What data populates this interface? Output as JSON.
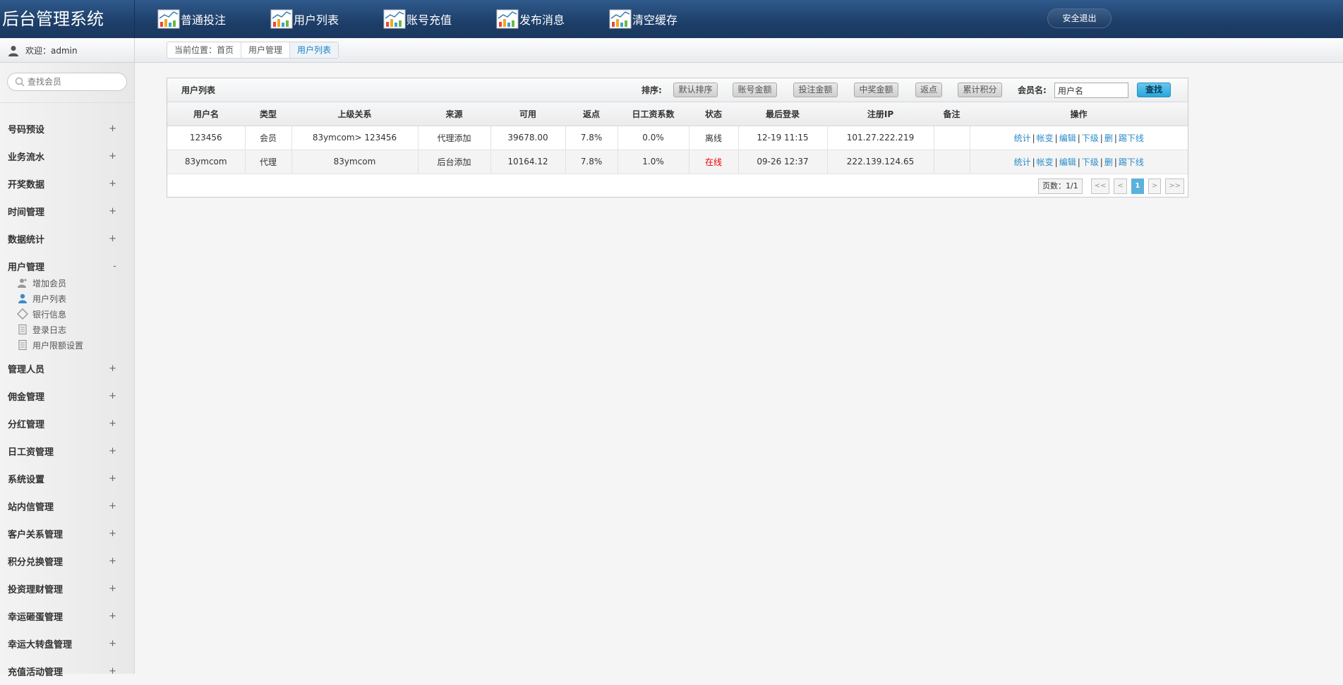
{
  "app": {
    "title": "后台管理系统"
  },
  "nav": [
    {
      "label": "普通投注"
    },
    {
      "label": "用户列表"
    },
    {
      "label": "账号充值"
    },
    {
      "label": "发布消息"
    },
    {
      "label": "清空缓存"
    }
  ],
  "logout_label": "安全退出",
  "welcome": "欢迎：admin",
  "breadcrumb": [
    "当前位置：首页",
    "用户管理",
    "用户列表"
  ],
  "sidebar": {
    "search_placeholder": "查找会员",
    "menu_before": [
      {
        "label": "号码预设",
        "sign": "+"
      },
      {
        "label": "业务流水",
        "sign": "+"
      },
      {
        "label": "开奖数据",
        "sign": "+"
      },
      {
        "label": "时间管理",
        "sign": "+"
      },
      {
        "label": "数据统计",
        "sign": "+"
      },
      {
        "label": "用户管理",
        "sign": "-"
      }
    ],
    "submenu": [
      {
        "label": "增加会员",
        "icon": "add-user-icon"
      },
      {
        "label": "用户列表",
        "icon": "user-icon"
      },
      {
        "label": "银行信息",
        "icon": "diamond-icon"
      },
      {
        "label": "登录日志",
        "icon": "document-icon"
      },
      {
        "label": "用户限额设置",
        "icon": "document-icon"
      }
    ],
    "menu_after": [
      {
        "label": "管理人员",
        "sign": "+"
      },
      {
        "label": "佣金管理",
        "sign": "+"
      },
      {
        "label": "分红管理",
        "sign": "+"
      },
      {
        "label": "日工资管理",
        "sign": "+"
      },
      {
        "label": "系统设置",
        "sign": "+"
      },
      {
        "label": "站内信管理",
        "sign": "+"
      },
      {
        "label": "客户关系管理",
        "sign": "+"
      },
      {
        "label": "积分兑换管理",
        "sign": "+"
      },
      {
        "label": "投资理财管理",
        "sign": "+"
      },
      {
        "label": "幸运砸蛋管理",
        "sign": "+"
      },
      {
        "label": "幸运大转盘管理",
        "sign": "+"
      },
      {
        "label": "充值活动管理",
        "sign": "+"
      }
    ]
  },
  "panel": {
    "title": "用户列表",
    "sort_label": "排序:",
    "sort_buttons": [
      "默认排序",
      "账号金额",
      "投注金额",
      "中奖金额",
      "返点",
      "累计积分"
    ],
    "member_label": "会员名:",
    "member_value": "用户名",
    "find_label": "查找"
  },
  "table": {
    "headers": [
      "用户名",
      "类型",
      "上级关系",
      "来源",
      "可用",
      "返点",
      "日工资系数",
      "状态",
      "最后登录",
      "注册IP",
      "备注",
      "操作"
    ],
    "rows": [
      {
        "cells": [
          "123456",
          "会员",
          "83ymcom> 123456",
          "代理添加",
          "39678.00",
          "7.8%",
          "0.0%",
          "离线",
          "12-19 11:15",
          "101.27.222.219",
          ""
        ],
        "online": false
      },
      {
        "cells": [
          "83ymcom",
          "代理",
          "83ymcom",
          "后台添加",
          "10164.12",
          "7.8%",
          "1.0%",
          "在线",
          "09-26 12:37",
          "222.139.124.65",
          ""
        ],
        "online": true
      }
    ],
    "actions": [
      "统计",
      "帐变",
      "编辑",
      "下级",
      "删",
      "踢下线"
    ]
  },
  "pager": {
    "info": "页数：1/1",
    "first": "<<",
    "prev": "<",
    "current": "1",
    "next": ">",
    "last": ">>"
  }
}
